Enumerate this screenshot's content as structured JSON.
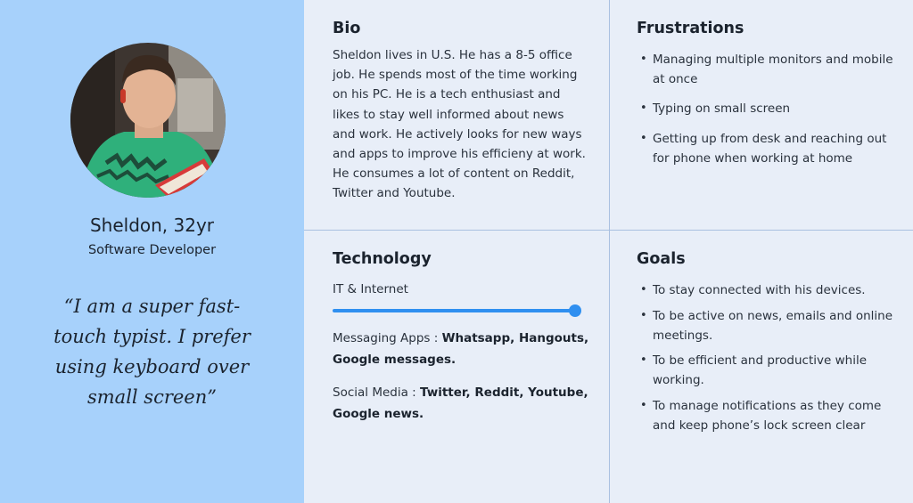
{
  "profile": {
    "name": "Sheldon, 32yr",
    "role": "Software Developer",
    "quote": "“I am a super fast-touch typist. I prefer using keyboard over small screen”"
  },
  "bio": {
    "title": "Bio",
    "text": "Sheldon lives in U.S. He has a 8-5 office job. He spends most of the time working on his PC. He is a tech enthusiast and likes to  stay well informed about news and work. He actively looks for new ways and apps to improve his efficieny at work. He consumes a lot of content on Reddit, Twitter and Youtube."
  },
  "frustrations": {
    "title": "Frustrations",
    "items": [
      "Managing multiple monitors and mobile at once",
      "Typing on small screen",
      "Getting up from desk and reaching out for phone when working at home"
    ]
  },
  "technology": {
    "title": "Technology",
    "it_label": "IT & Internet",
    "it_level": 1.0,
    "messaging_label": "Messaging Apps :",
    "messaging_value": "Whatsapp, Hangouts, Google messages.",
    "social_label": "Social Media :",
    "social_value": "Twitter, Reddit, Youtube, Google news."
  },
  "goals": {
    "title": "Goals",
    "items": [
      "To stay connected with his devices.",
      "To be active on news, emails and online meetings.",
      "To be efficient and productive while working.",
      "To manage notifications as they come and keep phone’s lock screen clear"
    ]
  },
  "colors": {
    "left_panel": "#a7d1fb",
    "right_panel": "#e8eef8",
    "accent": "#2f8ff0"
  }
}
